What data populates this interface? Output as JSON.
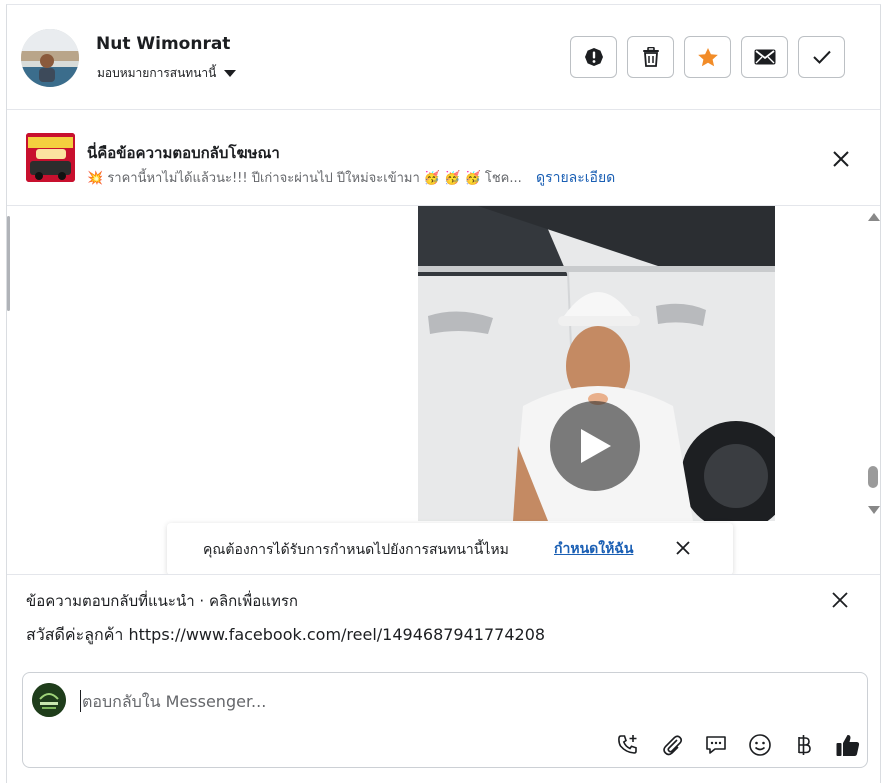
{
  "header": {
    "contact_name": "Nut Wimonrat",
    "assign_label": "มอบหมายการสนทนานี้",
    "actions": [
      {
        "name": "report-button",
        "icon": "exclamation-circle-icon"
      },
      {
        "name": "delete-button",
        "icon": "trash-icon"
      },
      {
        "name": "star-button",
        "icon": "star-icon"
      },
      {
        "name": "mark-unread-button",
        "icon": "envelope-icon"
      },
      {
        "name": "mark-done-button",
        "icon": "checkmark-icon"
      }
    ]
  },
  "ad_reply": {
    "title": "นี่คือข้อความตอบกลับโฆษณา",
    "description": "💥 ราคานี้หาไม่ได้แล้วนะ!!! ปีเก่าจะผ่านไป ปีใหม่จะเข้ามา 🥳 🥳 🥳 โชค...",
    "details_link": "ดูรายละเอียด"
  },
  "assign_prompt": {
    "text": "คุณต้องการได้รับการกำหนดไปยังการสนทนานี้ไหม",
    "link": "กำหนดให้ฉัน"
  },
  "suggested_reply": {
    "title": "ข้อความตอบกลับที่แนะนำ · คลิกเพื่อแทรก",
    "text": "สวัสดีค่ะลูกค้า https://www.facebook.com/reel/1494687941774208"
  },
  "composer": {
    "placeholder": "ตอบกลับใน Messenger...",
    "tools": [
      "add-call-icon",
      "paperclip-icon",
      "chat-bubble-icon",
      "emoji-icon",
      "baht-icon",
      "thumbs-up-icon"
    ]
  },
  "colors": {
    "star": "#f28c28",
    "link": "#1a5fb4",
    "border": "#bcc0c4"
  }
}
